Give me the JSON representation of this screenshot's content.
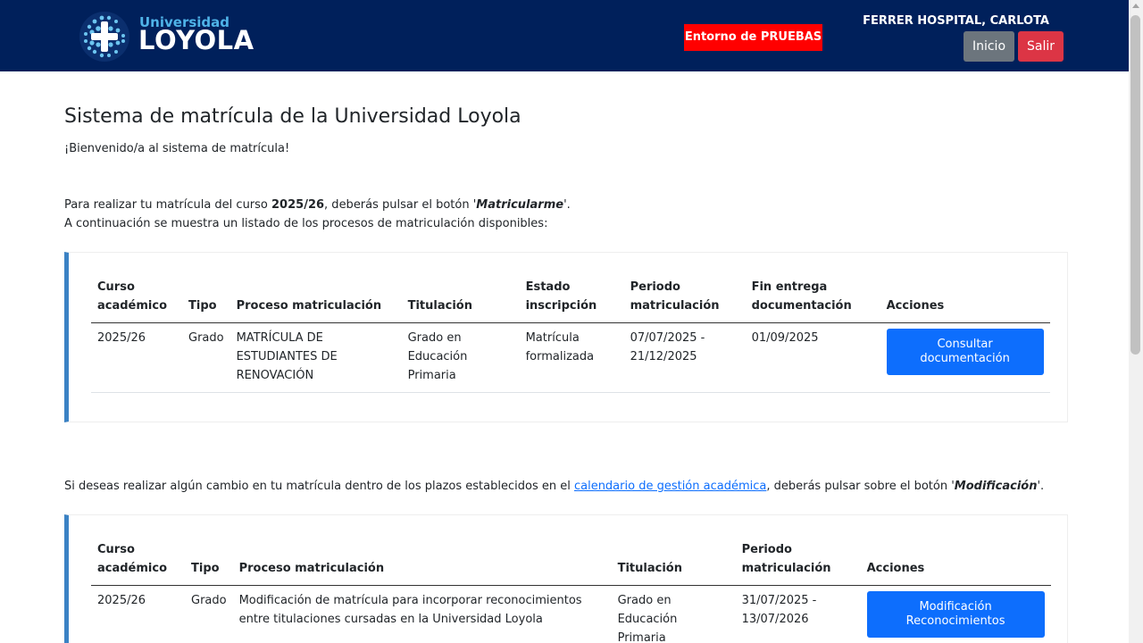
{
  "header": {
    "logo_small": "Universidad",
    "logo_big": "LOYOLA",
    "env_badge": "Entorno de PRUEBAS",
    "user_name": "FERRER HOSPITAL, CARLOTA",
    "inicio_label": "Inicio",
    "salir_label": "Salir"
  },
  "main": {
    "title": "Sistema de matrícula de la Universidad Loyola",
    "welcome": "¡Bienvenido/a al sistema de matrícula!",
    "intro_pre": "Para realizar tu matrícula del curso ",
    "intro_course": "2025/26",
    "intro_mid": ", deberás pulsar el botón '",
    "intro_button": "Matricularme",
    "intro_post": "'.",
    "intro_line2": "A continuación se muestra un listado de los procesos de matriculación disponibles:"
  },
  "table1": {
    "headers": [
      "Curso académico",
      "Tipo",
      "Proceso matriculación",
      "Titulación",
      "Estado inscripción",
      "Periodo matriculación",
      "Fin entrega documentación",
      "Acciones"
    ],
    "rows": [
      {
        "curso": "2025/26",
        "tipo": "Grado",
        "proceso": "MATRÍCULA DE ESTUDIANTES DE RENOVACIÓN",
        "titulacion": "Grado en Educación Primaria",
        "estado": "Matrícula formalizada",
        "periodo": "07/07/2025 - 21/12/2025",
        "fin": "01/09/2025",
        "accion": "Consultar documentación"
      }
    ]
  },
  "modification": {
    "pre": "Si deseas realizar algún cambio en tu matrícula dentro de los plazos establecidos en el ",
    "link": "calendario de gestión académica",
    "mid": ", deberás pulsar sobre el botón '",
    "button": "Modificación",
    "post": "'."
  },
  "table2": {
    "headers": [
      "Curso académico",
      "Tipo",
      "Proceso matriculación",
      "Titulación",
      "Periodo matriculación",
      "Acciones"
    ],
    "rows": [
      {
        "curso": "2025/26",
        "tipo": "Grado",
        "proceso": "Modificación de matrícula para incorporar reconocimientos entre titulaciones cursadas en la Universidad Loyola",
        "titulacion": "Grado en Educación Primaria",
        "periodo": "31/07/2025 - 13/07/2026",
        "accion": "Modificación Reconocimientos"
      }
    ]
  },
  "colors": {
    "header_bg": "#00205b",
    "env_badge": "#ff0000",
    "btn_primary": "#0d6efd",
    "btn_inicio": "#6c757d",
    "btn_salir": "#dc3545",
    "card_accent": "#3b82c4"
  }
}
